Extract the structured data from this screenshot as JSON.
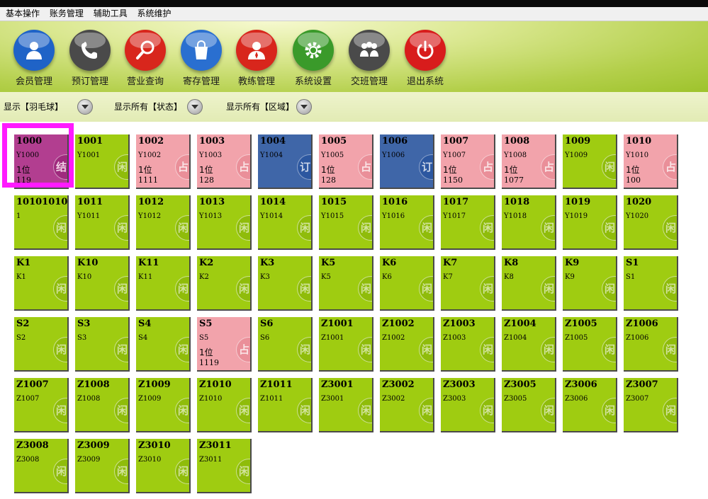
{
  "menu": [
    "基本操作",
    "账务管理",
    "辅助工具",
    "系统维护"
  ],
  "toolbar": [
    {
      "label": "会员管理",
      "icon": "member-icon",
      "color": "#1f63c7"
    },
    {
      "label": "预订管理",
      "icon": "phone-icon",
      "color": "#4a4a4a"
    },
    {
      "label": "营业查询",
      "icon": "search-icon",
      "color": "#d8261c"
    },
    {
      "label": "寄存管理",
      "icon": "bag-icon",
      "color": "#2a6fd0"
    },
    {
      "label": "教练管理",
      "icon": "coach-icon",
      "color": "#d8261c"
    },
    {
      "label": "系统设置",
      "icon": "gear-icon",
      "color": "#3a9a2a"
    },
    {
      "label": "交班管理",
      "icon": "team-icon",
      "color": "#4a4a4a"
    },
    {
      "label": "退出系统",
      "icon": "power-icon",
      "color": "#d81c1c"
    }
  ],
  "filters": [
    "显示【羽毛球】",
    "显示所有【状态】",
    "显示所有【区域】"
  ],
  "status_badges": {
    "green": "闲",
    "pink": "占",
    "blue": "订",
    "purple": "结"
  },
  "colors": {
    "idle": "#9fcc11",
    "occupied": "#f2a3ab",
    "reserved": "#3f66a8",
    "checkout": "#b23e90",
    "selection": "#ff1aff"
  },
  "tiles": [
    {
      "name": "1000",
      "code": "Y1000",
      "status": "purple",
      "l3": "1位",
      "l4": "119"
    },
    {
      "name": "1001",
      "code": "Y1001",
      "status": "green"
    },
    {
      "name": "1002",
      "code": "Y1002",
      "status": "pink",
      "l3": "1位",
      "l4": "1111"
    },
    {
      "name": "1003",
      "code": "Y1003",
      "status": "pink",
      "l3": "1位",
      "l4": "128"
    },
    {
      "name": "1004",
      "code": "Y1004",
      "status": "blue"
    },
    {
      "name": "1005",
      "code": "Y1005",
      "status": "pink",
      "l3": "1位",
      "l4": "128"
    },
    {
      "name": "1006",
      "code": "Y1006",
      "status": "blue"
    },
    {
      "name": "1007",
      "code": "Y1007",
      "status": "pink",
      "l3": "1位",
      "l4": "1150"
    },
    {
      "name": "1008",
      "code": "Y1008",
      "status": "pink",
      "l3": "1位",
      "l4": "1077"
    },
    {
      "name": "1009",
      "code": "Y1009",
      "status": "green"
    },
    {
      "name": "1010",
      "code": "Y1010",
      "status": "pink",
      "l3": "1位",
      "l4": "100"
    },
    {
      "name": "10101010",
      "code": "1",
      "status": "green"
    },
    {
      "name": "1011",
      "code": "Y1011",
      "status": "green"
    },
    {
      "name": "1012",
      "code": "Y1012",
      "status": "green"
    },
    {
      "name": "1013",
      "code": "Y1013",
      "status": "green"
    },
    {
      "name": "1014",
      "code": "Y1014",
      "status": "green"
    },
    {
      "name": "1015",
      "code": "Y1015",
      "status": "green"
    },
    {
      "name": "1016",
      "code": "Y1016",
      "status": "green"
    },
    {
      "name": "1017",
      "code": "Y1017",
      "status": "green"
    },
    {
      "name": "1018",
      "code": "Y1018",
      "status": "green"
    },
    {
      "name": "1019",
      "code": "Y1019",
      "status": "green"
    },
    {
      "name": "1020",
      "code": "Y1020",
      "status": "green"
    },
    {
      "name": "K1",
      "code": "K1",
      "status": "green"
    },
    {
      "name": "K10",
      "code": "K10",
      "status": "green"
    },
    {
      "name": "K11",
      "code": "K11",
      "status": "green"
    },
    {
      "name": "K2",
      "code": "K2",
      "status": "green"
    },
    {
      "name": "K3",
      "code": "K3",
      "status": "green"
    },
    {
      "name": "K5",
      "code": "K5",
      "status": "green"
    },
    {
      "name": "K6",
      "code": "K6",
      "status": "green"
    },
    {
      "name": "K7",
      "code": "K7",
      "status": "green"
    },
    {
      "name": "K8",
      "code": "K8",
      "status": "green"
    },
    {
      "name": "K9",
      "code": "K9",
      "status": "green"
    },
    {
      "name": "S1",
      "code": "S1",
      "status": "green"
    },
    {
      "name": "S2",
      "code": "S2",
      "status": "green"
    },
    {
      "name": "S3",
      "code": "S3",
      "status": "green"
    },
    {
      "name": "S4",
      "code": "S4",
      "status": "green"
    },
    {
      "name": "S5",
      "code": "S5",
      "status": "pink",
      "l3": "1位",
      "l4": "1119"
    },
    {
      "name": "S6",
      "code": "S6",
      "status": "green"
    },
    {
      "name": "Z1001",
      "code": "Z1001",
      "status": "green"
    },
    {
      "name": "Z1002",
      "code": "Z1002",
      "status": "green"
    },
    {
      "name": "Z1003",
      "code": "Z1003",
      "status": "green"
    },
    {
      "name": "Z1004",
      "code": "Z1004",
      "status": "green"
    },
    {
      "name": "Z1005",
      "code": "Z1005",
      "status": "green"
    },
    {
      "name": "Z1006",
      "code": "Z1006",
      "status": "green"
    },
    {
      "name": "Z1007",
      "code": "Z1007",
      "status": "green"
    },
    {
      "name": "Z1008",
      "code": "Z1008",
      "status": "green"
    },
    {
      "name": "Z1009",
      "code": "Z1009",
      "status": "green"
    },
    {
      "name": "Z1010",
      "code": "Z1010",
      "status": "green"
    },
    {
      "name": "Z1011",
      "code": "Z1011",
      "status": "green"
    },
    {
      "name": "Z3001",
      "code": "Z3001",
      "status": "green"
    },
    {
      "name": "Z3002",
      "code": "Z3002",
      "status": "green"
    },
    {
      "name": "Z3003",
      "code": "Z3003",
      "status": "green"
    },
    {
      "name": "Z3005",
      "code": "Z3005",
      "status": "green"
    },
    {
      "name": "Z3006",
      "code": "Z3006",
      "status": "green"
    },
    {
      "name": "Z3007",
      "code": "Z3007",
      "status": "green"
    },
    {
      "name": "Z3008",
      "code": "Z3008",
      "status": "green"
    },
    {
      "name": "Z3009",
      "code": "Z3009",
      "status": "green"
    },
    {
      "name": "Z3010",
      "code": "Z3010",
      "status": "green"
    },
    {
      "name": "Z3011",
      "code": "Z3011",
      "status": "green"
    }
  ]
}
